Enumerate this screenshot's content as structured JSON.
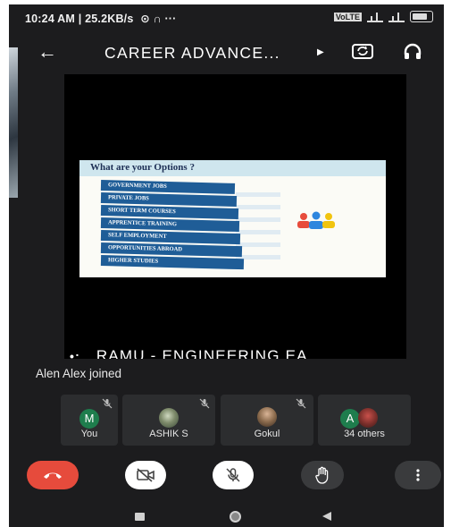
{
  "status_bar": {
    "time": "10:24 AM",
    "speed": "25.2KB/s",
    "extra": "⊙ ∩ ···",
    "volte": "VoLTE",
    "colors": {
      "text": "#f2f2f2"
    }
  },
  "top_bar": {
    "back_icon": "arrow-left-icon",
    "title": "CAREER ADVANCE...",
    "play_icon": "play-icon",
    "camera_flip_icon": "camera-flip-icon",
    "audio_icon": "headset-icon"
  },
  "slide": {
    "title": "What are your Options ?",
    "options": [
      "GOVERNMENT JOBS",
      "PRIVATE JOBS",
      "SHORT TERM COURSES",
      "APPRENTICE TRAINING",
      "SELF EMPLOYMENT",
      "OPPORTUNITIES ABROAD",
      "HIGHER STUDIES"
    ],
    "option_color": "#1f5d97"
  },
  "presenter": {
    "name": "RAMU - ENGINEERING EA"
  },
  "notification": "Alen Alex joined",
  "participants": [
    {
      "label": "You",
      "avatar_letter": "M",
      "muted": true
    },
    {
      "label": "ASHIK S",
      "muted": true
    },
    {
      "label": "Gokul",
      "muted": true
    },
    {
      "label": "34 others",
      "avatar_letter": "A",
      "muted": true
    }
  ],
  "controls": {
    "end_call_icon": "end-call-icon",
    "camera_off_icon": "camera-off-icon",
    "mic_off_icon": "mic-off-icon",
    "raise_hand_icon": "raise-hand-icon",
    "more_icon": "more-vertical-icon",
    "end_call_color": "#e64b3c"
  },
  "nav": {
    "recents_icon": "square-icon",
    "home_icon": "circle-icon",
    "back_icon": "triangle-back-icon"
  }
}
